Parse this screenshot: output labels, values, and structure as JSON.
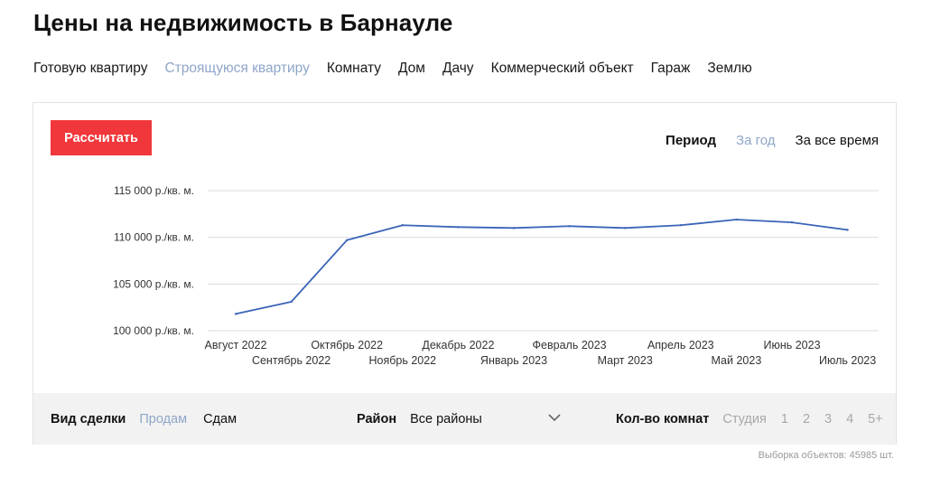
{
  "page": {
    "title": "Цены на недвижимость в Барнауле"
  },
  "property_types": [
    {
      "label": "Готовую квартиру",
      "active": false
    },
    {
      "label": "Строящуюся квартиру",
      "active": true
    },
    {
      "label": "Комнату",
      "active": false
    },
    {
      "label": "Дом",
      "active": false
    },
    {
      "label": "Дачу",
      "active": false
    },
    {
      "label": "Коммерческий объект",
      "active": false
    },
    {
      "label": "Гараж",
      "active": false
    },
    {
      "label": "Землю",
      "active": false
    }
  ],
  "toolbar": {
    "calc_label": "Рассчитать"
  },
  "period": {
    "label": "Период",
    "options": [
      {
        "label": "За год",
        "active": true
      },
      {
        "label": "За все время",
        "active": false
      }
    ]
  },
  "chart_data": {
    "type": "line",
    "categories": [
      "Август 2022",
      "Сентябрь 2022",
      "Октябрь 2022",
      "Ноябрь 2022",
      "Декабрь 2022",
      "Январь 2023",
      "Февраль 2023",
      "Март 2023",
      "Апрель 2023",
      "Май 2023",
      "Июнь 2023",
      "Июль 2023"
    ],
    "values": [
      101800,
      103100,
      109700,
      111300,
      111100,
      111000,
      111200,
      111000,
      111300,
      111900,
      111600,
      110800
    ],
    "yticks": [
      100000,
      105000,
      110000,
      115000
    ],
    "ytick_labels": [
      "100 000 р./кв. м.",
      "105 000 р./кв. м.",
      "110 000 р./кв. м.",
      "115 000 р./кв. м."
    ],
    "ylim": [
      100000,
      115000
    ],
    "grid": true,
    "line_color": "#3b64b8"
  },
  "filters": {
    "deal": {
      "label": "Вид сделки",
      "options": [
        {
          "label": "Продам",
          "active": true
        },
        {
          "label": "Сдам",
          "active": false
        }
      ]
    },
    "district": {
      "label": "Район",
      "value": "Все районы"
    },
    "rooms": {
      "label": "Кол-во комнат",
      "options": [
        "Студия",
        "1",
        "2",
        "3",
        "4",
        "5+"
      ]
    }
  },
  "footer": {
    "count_text": "Выборка объектов: 45985 шт."
  }
}
